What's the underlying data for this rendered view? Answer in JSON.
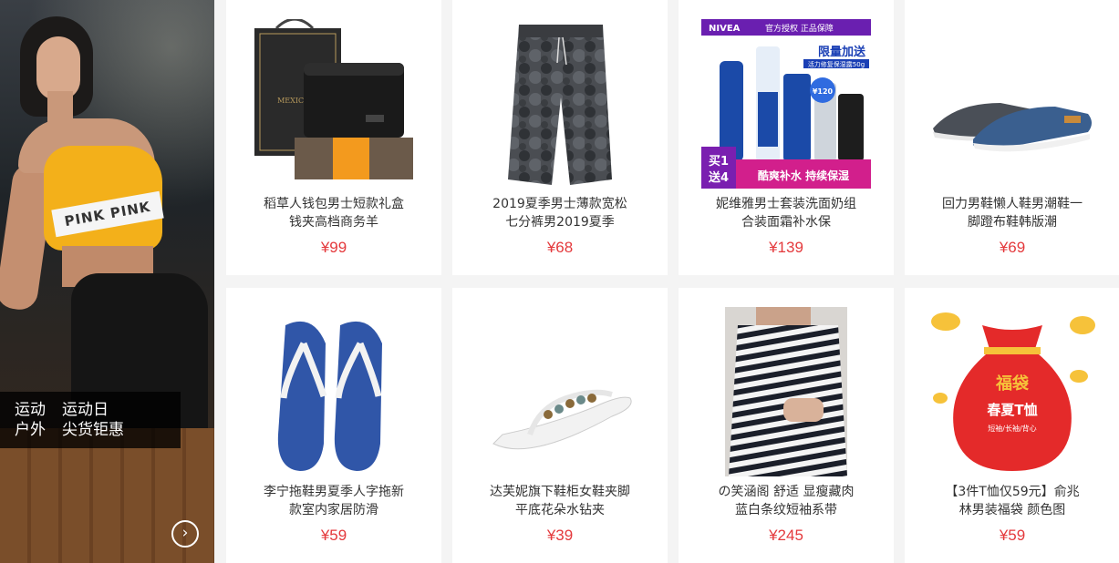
{
  "banner": {
    "tag_left": "运动\n户外",
    "tag_right": "运动日\n尖货钜惠",
    "shirt_text": "PINK PINK",
    "next_icon": "chevron-right-icon"
  },
  "products": [
    {
      "name": "稻草人钱包男士短款礼盒钱夹高档商务羊",
      "price": "¥99"
    },
    {
      "name": "2019夏季男士薄款宽松七分裤男2019夏季",
      "price": "¥68"
    },
    {
      "name": "妮维雅男士套装洗面奶组合装面霜补水保",
      "price": "¥139"
    },
    {
      "name": "回力男鞋懒人鞋男潮鞋一脚蹬布鞋韩版潮",
      "price": "¥69"
    },
    {
      "name": "李宁拖鞋男夏季人字拖新款室内家居防滑",
      "price": "¥59"
    },
    {
      "name": "达芙妮旗下鞋柜女鞋夹脚平底花朵水钻夹",
      "price": "¥39"
    },
    {
      "name": "の笑涵阁 舒适 显瘦藏肉蓝白条纹短袖系带",
      "price": "¥245"
    },
    {
      "name": "【3件T恤仅59元】俞兆林男装福袋 颜色图",
      "price": "¥59"
    }
  ],
  "nivea": {
    "brand": "NIVEA",
    "header": "官方授权 正品保障",
    "promo": "限量加送",
    "promo_sub": "活力修复保湿露50g",
    "price_badge": "¥120",
    "bundle": "买1\n送4",
    "slogan": "酷爽补水 持续保湿"
  },
  "lucky_bag": {
    "title": "福袋",
    "subtitle": "春夏T恤",
    "caption": "短袖/长袖/背心"
  },
  "colors": {
    "price": "#e4393c",
    "background": "#f4f4f4"
  }
}
